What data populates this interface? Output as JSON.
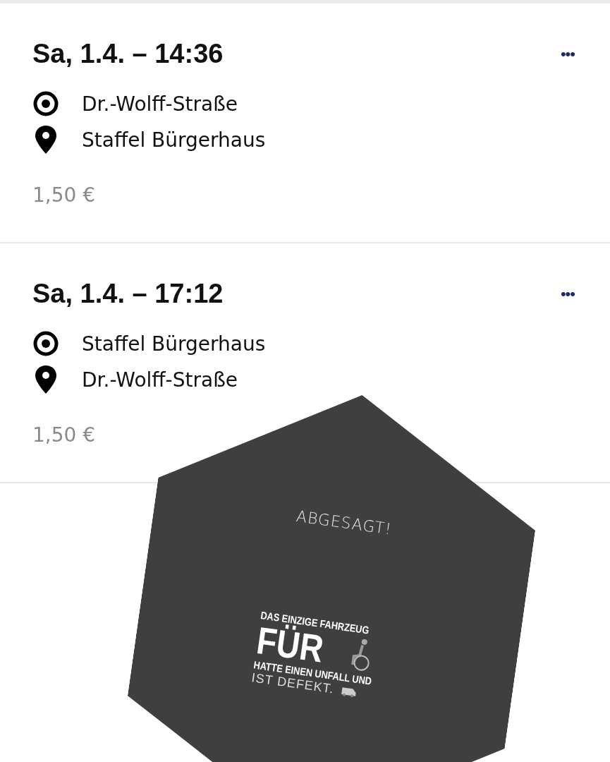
{
  "rides": [
    {
      "date_time": "Sa, 1.4. – 14:36",
      "from": "Dr.-Wolff-Straße",
      "to": "Staffel Bürgerhaus",
      "price": "1,50 €",
      "menu": "•••"
    },
    {
      "date_time": "Sa, 1.4. – 17:12",
      "from": "Staffel Bürgerhaus",
      "to": "Dr.-Wolff-Straße",
      "price": "1,50 €",
      "menu": "•••"
    }
  ],
  "sticker": {
    "headline": "ABGESAGT!",
    "line_1": "DAS EINZIGE FAHRZEUG",
    "line_2": "FÜR",
    "line_3": "HATTE EINEN UNFALL UND",
    "line_4": "IST DEFEKT."
  }
}
